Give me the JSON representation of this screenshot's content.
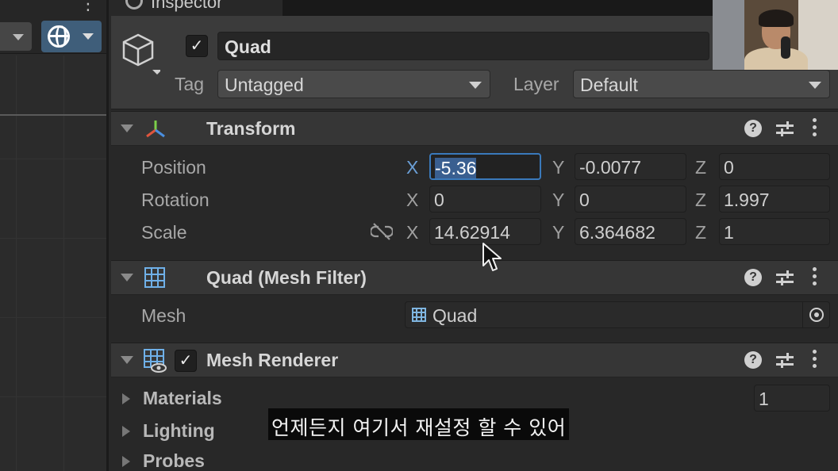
{
  "inspector": {
    "tab_title": "Inspector"
  },
  "gameobject": {
    "active": true,
    "name": "Quad",
    "tag_label": "Tag",
    "tag_value": "Untagged",
    "layer_label": "Layer",
    "layer_value": "Default"
  },
  "transform": {
    "title": "Transform",
    "position": {
      "label": "Position",
      "x": "-5.36",
      "y": "-0.0077",
      "z": "0"
    },
    "rotation": {
      "label": "Rotation",
      "x": "0",
      "y": "0",
      "z": "1.997"
    },
    "scale": {
      "label": "Scale",
      "x": "14.62914",
      "y": "6.364682",
      "z": "1"
    },
    "axis_x": "X",
    "axis_y": "Y",
    "axis_z": "Z"
  },
  "mesh_filter": {
    "title": "Quad (Mesh Filter)",
    "mesh_label": "Mesh",
    "mesh_value": "Quad"
  },
  "mesh_renderer": {
    "title": "Mesh Renderer",
    "enabled": true,
    "materials_label": "Materials",
    "materials_count": "1",
    "lighting_label": "Lighting",
    "probes_label": "Probes"
  },
  "caption": {
    "text": "언제든지 여기서 재설정 할 수 있어"
  },
  "colors": {
    "accent": "#3a79bb",
    "icon_blue": "#6fb0e8",
    "panel": "#282828",
    "header": "#3b3b3b"
  },
  "icons": {
    "header": "cube-icon",
    "transform": "transform-axes-icon",
    "mesh_filter": "mesh-grid-icon",
    "mesh_renderer": "mesh-renderer-icon"
  }
}
